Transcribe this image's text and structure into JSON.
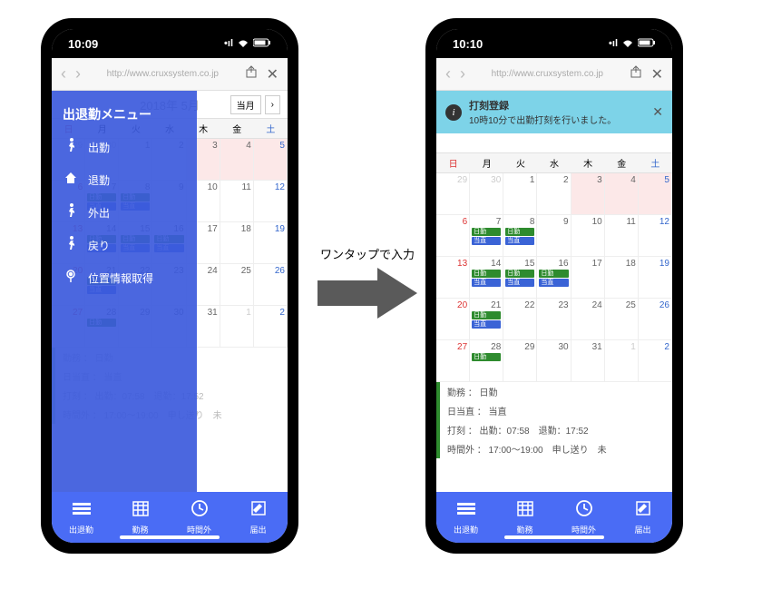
{
  "left": {
    "time": "10:09",
    "signal": "•ıl",
    "wifi": "⌃",
    "battery": "▮"
  },
  "right": {
    "time": "10:10",
    "signal": "•ıl",
    "wifi": "⌃",
    "battery": "▮"
  },
  "url": "http://www.cruxsystem.co.jp",
  "calendar": {
    "title": "2018年 5月",
    "current_btn": "当月",
    "weekdays": [
      "日",
      "月",
      "火",
      "水",
      "木",
      "金",
      "土"
    ],
    "days": [
      {
        "n": "29",
        "cls": "other"
      },
      {
        "n": "30",
        "cls": "other"
      },
      {
        "n": "1",
        "cls": ""
      },
      {
        "n": "2",
        "cls": ""
      },
      {
        "n": "3",
        "cls": "hol"
      },
      {
        "n": "4",
        "cls": "hol"
      },
      {
        "n": "5",
        "cls": "sat hol"
      },
      {
        "n": "6",
        "cls": "sun"
      },
      {
        "n": "7",
        "cls": "",
        "tags": [
          "g",
          "b",
          "r"
        ]
      },
      {
        "n": "8",
        "cls": "",
        "tags": [
          "g",
          "b"
        ]
      },
      {
        "n": "9",
        "cls": ""
      },
      {
        "n": "10",
        "cls": ""
      },
      {
        "n": "11",
        "cls": ""
      },
      {
        "n": "12",
        "cls": "sat"
      },
      {
        "n": "13",
        "cls": "sun"
      },
      {
        "n": "14",
        "cls": "",
        "tags": [
          "g",
          "b",
          "r"
        ]
      },
      {
        "n": "15",
        "cls": "",
        "tags": [
          "g",
          "b"
        ]
      },
      {
        "n": "16",
        "cls": "",
        "tags": [
          "g",
          "b"
        ]
      },
      {
        "n": "17",
        "cls": ""
      },
      {
        "n": "18",
        "cls": ""
      },
      {
        "n": "19",
        "cls": "sat"
      },
      {
        "n": "20",
        "cls": "sun"
      },
      {
        "n": "21",
        "cls": "",
        "tags": [
          "g",
          "b",
          "r"
        ]
      },
      {
        "n": "22",
        "cls": ""
      },
      {
        "n": "23",
        "cls": ""
      },
      {
        "n": "24",
        "cls": ""
      },
      {
        "n": "25",
        "cls": ""
      },
      {
        "n": "26",
        "cls": "sat"
      },
      {
        "n": "27",
        "cls": "sun"
      },
      {
        "n": "28",
        "cls": "",
        "tags": [
          "g"
        ]
      },
      {
        "n": "29",
        "cls": ""
      },
      {
        "n": "30",
        "cls": ""
      },
      {
        "n": "31",
        "cls": ""
      },
      {
        "n": "1",
        "cls": "other"
      },
      {
        "n": "2",
        "cls": "other sat"
      }
    ]
  },
  "tags": {
    "g": "日勤",
    "b": "当直",
    "r": ""
  },
  "menu": {
    "title": "出退勤メニュー",
    "items": [
      {
        "icon": "walk",
        "label": "出勤"
      },
      {
        "icon": "home",
        "label": "退勤"
      },
      {
        "icon": "walk",
        "label": "外出"
      },
      {
        "icon": "walk",
        "label": "戻り"
      },
      {
        "icon": "pin",
        "label": "位置情報取得"
      }
    ]
  },
  "notification": {
    "title": "打刻登録",
    "body": "10時10分で出勤打刻を行いました。"
  },
  "details": [
    "勤務 ： 日勤",
    "日当直 ： 当直",
    "打刻 ： 出勤：07:58　退勤：17:52",
    "時間外 ： 17:00～19:00　申し送り　未"
  ],
  "details_left": {
    "line3_suffix": "17:52",
    "line4_suffix": "未"
  },
  "bottom_nav": [
    {
      "icon": "☰",
      "label": "出退勤"
    },
    {
      "icon": "▦",
      "label": "勤務"
    },
    {
      "icon": "◔",
      "label": "時間外"
    },
    {
      "icon": "✎",
      "label": "届出"
    }
  ],
  "arrow_label": "ワンタップで入力"
}
